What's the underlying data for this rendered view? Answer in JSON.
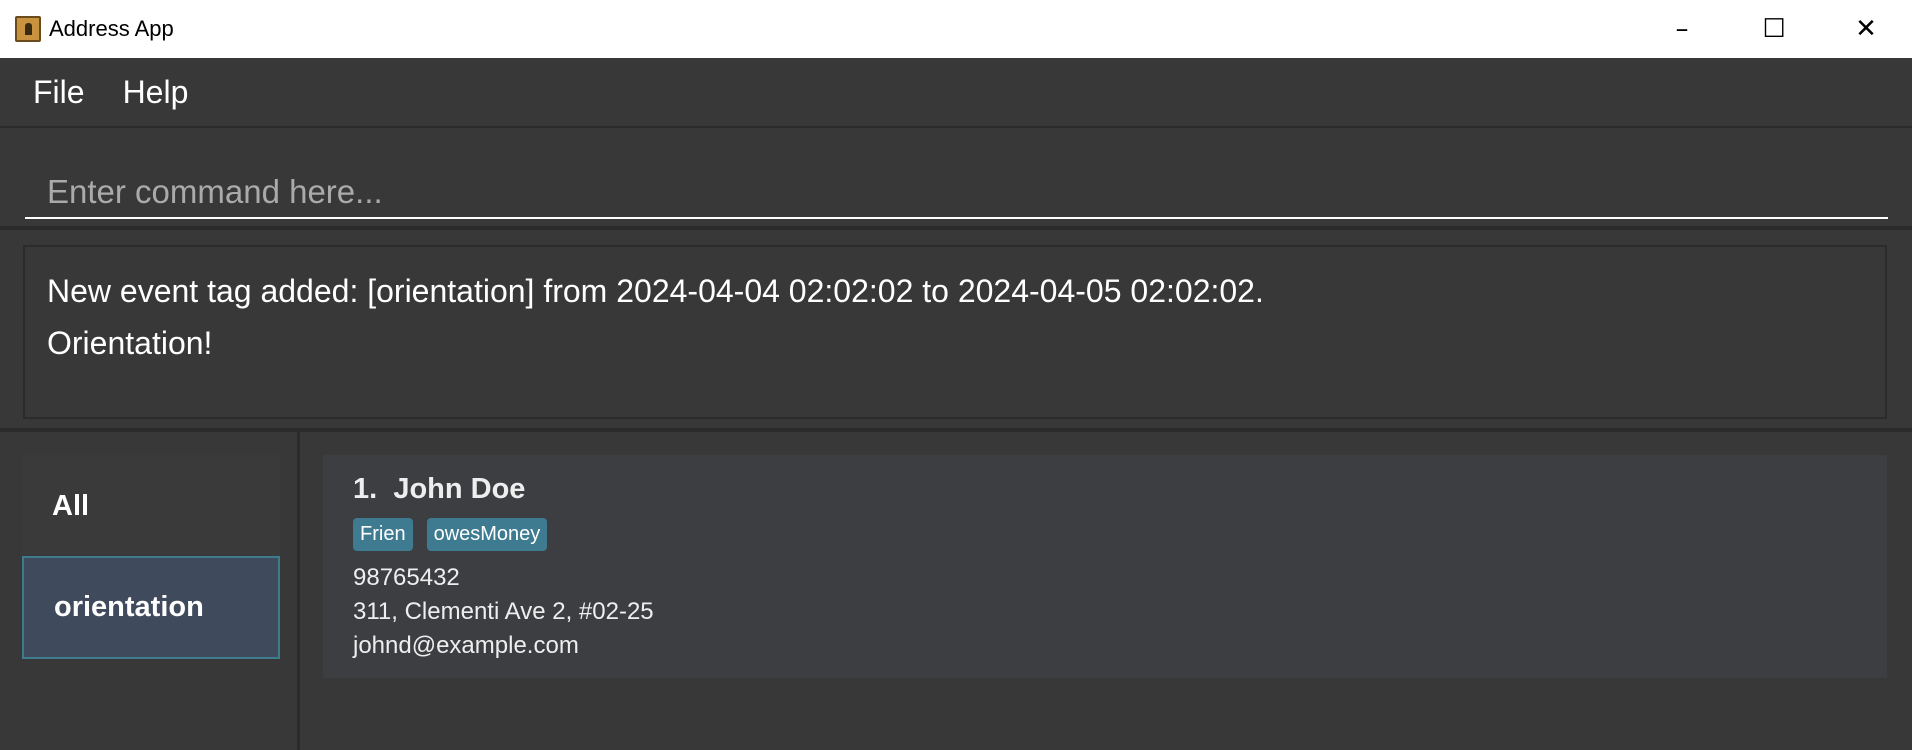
{
  "window": {
    "title": "Address App",
    "controls": {
      "minimize": "–",
      "maximize": "☐",
      "close": "✕"
    }
  },
  "menu": {
    "items": [
      {
        "label": "File"
      },
      {
        "label": "Help"
      }
    ]
  },
  "command": {
    "placeholder": "Enter command here...",
    "value": ""
  },
  "result": {
    "lines": [
      "New event tag added: [orientation] from 2024-04-04 02:02:02 to 2024-04-05 02:02:02.",
      "Orientation!"
    ]
  },
  "sidebar": {
    "items": [
      {
        "label": "All",
        "selected": false
      },
      {
        "label": "orientation",
        "selected": true
      }
    ]
  },
  "persons": [
    {
      "index": "1.",
      "name": "John Doe",
      "tags": [
        "Frien",
        "owesMoney"
      ],
      "phone": "98765432",
      "address": "311, Clementi Ave 2, #02-25",
      "email": "johnd@example.com"
    }
  ],
  "colors": {
    "background": "#383838",
    "card": "#3c3e42",
    "tag": "#3e7b91",
    "selected": "#3f4a5c",
    "selected_border": "#3d7c8c"
  }
}
